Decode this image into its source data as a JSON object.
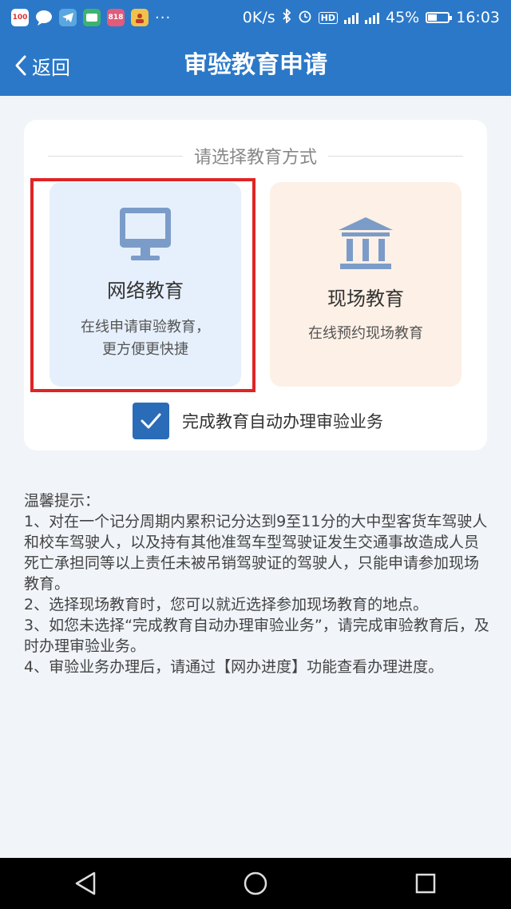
{
  "status_bar": {
    "app_icons": [
      "100",
      "chat",
      "telegram",
      "wechat",
      "818",
      "user"
    ],
    "dots": "···",
    "net_speed": "0K/s",
    "hd": "HD",
    "battery": "45%",
    "battery_level": 0.45,
    "time": "16:03",
    "color": "#2b78c8"
  },
  "nav": {
    "back_label": "返回",
    "title": "审验教育申请"
  },
  "card": {
    "section_title": "请选择教育方式",
    "online": {
      "title": "网络教育",
      "desc_line1": "在线申请审验教育，",
      "desc_line2": "更方便更快捷",
      "icon": "computer-monitor-icon"
    },
    "onsite": {
      "title": "现场教育",
      "desc": "在线预约现场教育",
      "icon": "bank-building-icon"
    },
    "auto_checkbox_checked": true,
    "auto_label": "完成教育自动办理审验业务"
  },
  "tips": {
    "heading": "温馨提示：",
    "items": [
      "1、对在一个记分周期内累积记分达到9至11分的大中型客货车驾驶人和校车驾驶人，以及持有其他准驾车型驾驶证发生交通事故造成人员死亡承担同等以上责任未被吊销驾驶证的驾驶人，只能申请参加现场教育。",
      "2、选择现场教育时，您可以就近选择参加现场教育的地点。",
      "3、如您未选择“完成教育自动办理审验业务”，请完成审验教育后，及时办理审验业务。",
      "4、审验业务办理后，请通过【网办进度】功能查看办理进度。"
    ]
  },
  "colors": {
    "primary": "#2b78c8",
    "highlight_border": "#e02424",
    "online_bg": "#e6f0fc",
    "onsite_bg": "#fdf0e6"
  }
}
